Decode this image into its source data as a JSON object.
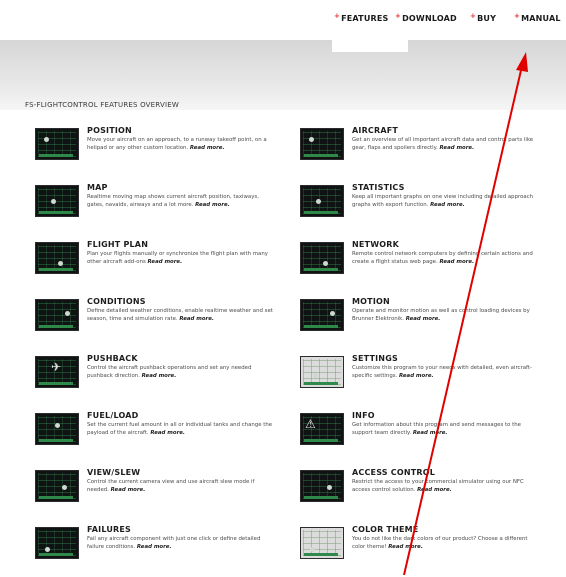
{
  "nav": {
    "features": "FEATURES",
    "download": "DOWNLOAD",
    "buy": "BUY",
    "manual": "MANUAL",
    "plus": "+"
  },
  "section_title": "FS-FLIGHTCONTROL FEATURES OVERVIEW",
  "read_more": "Read more.",
  "features_left": [
    {
      "name": "POSITION",
      "desc": "Move your aircraft on an approach, to a runway takeoff point, on a helipad or any other custom location."
    },
    {
      "name": "MAP",
      "desc": "Realtime moving map shows current aircraft position, taxiways, gates, navaids, airways and a lot more."
    },
    {
      "name": "FLIGHT PLAN",
      "desc": "Plan your flights manually or synchronize the flight plan with many other aircraft add-ons"
    },
    {
      "name": "CONDITIONS",
      "desc": "Define detailed weather conditions, enable realtime weather and set season, time and simulation rate."
    },
    {
      "name": "PUSHBACK",
      "desc": "Control the aircraft pushback operations and set any needed pushback direction."
    },
    {
      "name": "FUEL/LOAD",
      "desc": "Set the current fuel amount in all or individual tanks and change the payload of the aircraft."
    },
    {
      "name": "VIEW/SLEW",
      "desc": "Control the current camera view and use aircraft slew mode if needed."
    },
    {
      "name": "FAILURES",
      "desc": "Fail any aircraft component with just one click or define detailed failure conditions."
    }
  ],
  "features_right": [
    {
      "name": "AIRCRAFT",
      "desc": "Get an overview of all important aircraft data and control parts like gear, flaps and spoilers directly."
    },
    {
      "name": "STATISTICS",
      "desc": "Keep all important graphs on one view including detailed approach graphs with export function."
    },
    {
      "name": "NETWORK",
      "desc": "Remote control network computers by defining certain actions and create a flight status web page."
    },
    {
      "name": "MOTION",
      "desc": "Operate and monitor motion as well as control loading devices by Brunner Elektronik."
    },
    {
      "name": "SETTINGS",
      "desc": "Customize this program to your needs with detailed, even aircraft-specific settings."
    },
    {
      "name": "INFO",
      "desc": "Get information about this program and send messages to the support team directly."
    },
    {
      "name": "ACCESS CONTROL",
      "desc": "Restrict the access to your commercial simulator using our NFC access control solution."
    },
    {
      "name": "COLOR THEME",
      "desc": "You do not like the dark colors of our product? Choose a different color theme!"
    }
  ],
  "colors": {
    "accent": "#e53030",
    "annotation_arrow": "#e00000",
    "thumb_dark": "#101313",
    "thumb_green": "#2f8a4a"
  },
  "icons": {
    "pushback_thumb": "airplane-icon",
    "info_thumb": "warning-icon"
  }
}
